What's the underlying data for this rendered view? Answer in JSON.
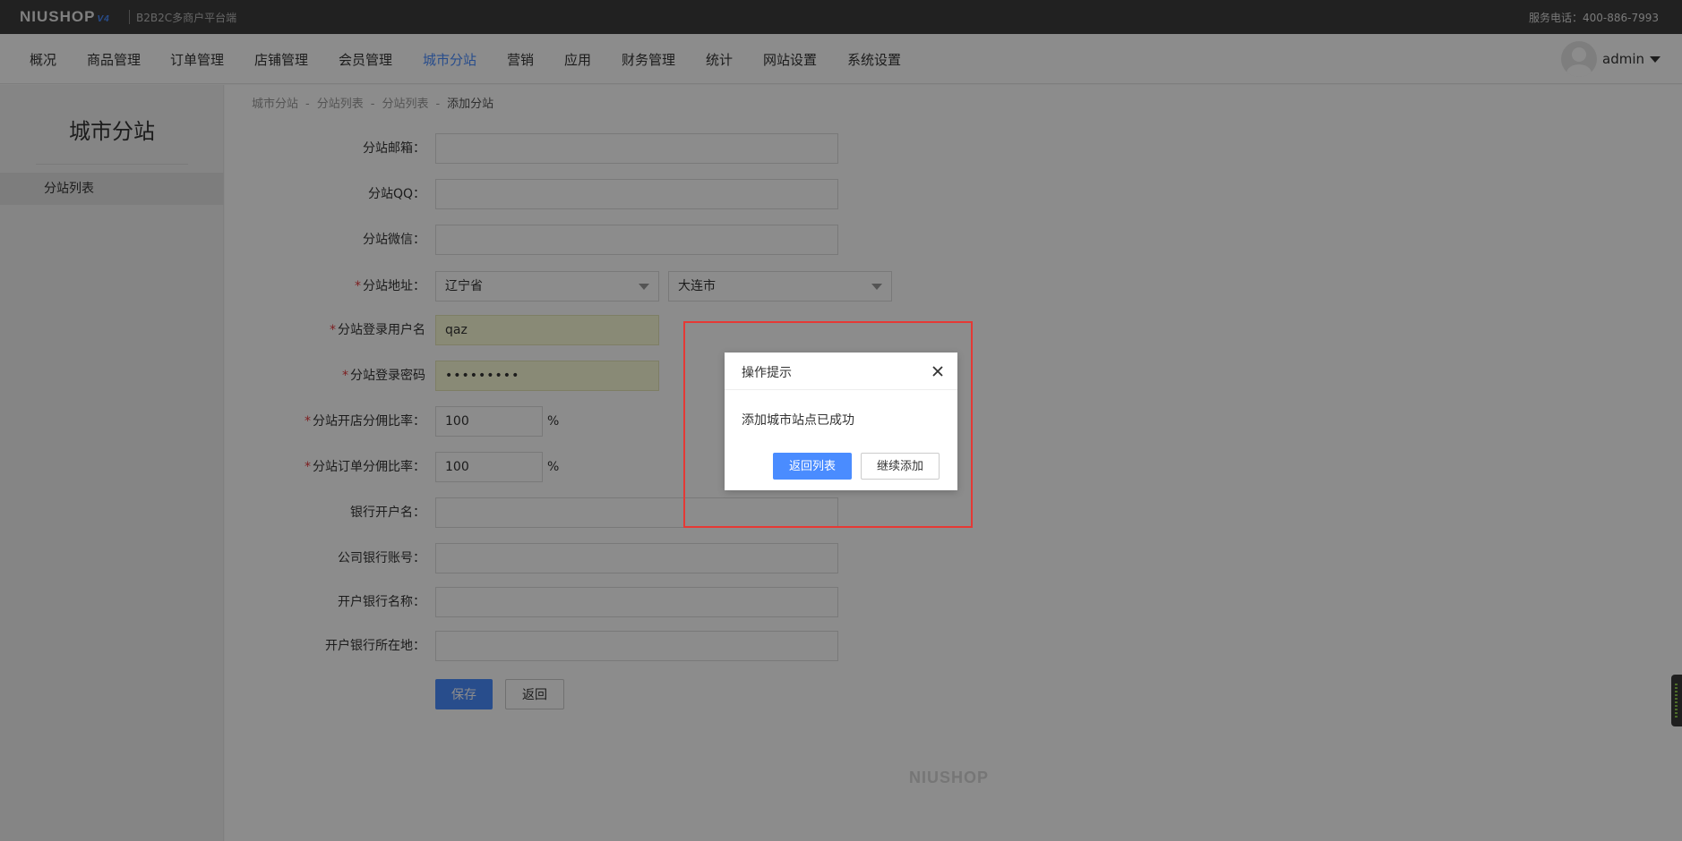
{
  "topbar": {
    "logo": "NIUSHOP",
    "logo_version": "V4",
    "subtitle": "B2B2C多商户平台端",
    "hotline": "服务电话：400-886-7993"
  },
  "nav": {
    "items": [
      "概况",
      "商品管理",
      "订单管理",
      "店铺管理",
      "会员管理",
      "城市分站",
      "营销",
      "应用",
      "财务管理",
      "统计",
      "网站设置",
      "系统设置"
    ],
    "active_index": 5,
    "user": "admin"
  },
  "sidebar": {
    "title": "城市分站",
    "items": [
      "分站列表"
    ]
  },
  "breadcrumb": [
    "城市分站",
    "分站列表",
    "分站列表",
    "添加分站"
  ],
  "form": {
    "email": {
      "label": "分站邮箱：",
      "value": ""
    },
    "qq": {
      "label": "分站QQ：",
      "value": ""
    },
    "wechat": {
      "label": "分站微信：",
      "value": ""
    },
    "address": {
      "label": "分站地址：",
      "province": "辽宁省",
      "city": "大连市"
    },
    "username": {
      "label": "分站登录用户名",
      "value": "qaz"
    },
    "password": {
      "label": "分站登录密码",
      "value": "•••••••••"
    },
    "shop_rate": {
      "label": "分站开店分佣比率：",
      "value": "100",
      "unit": "%"
    },
    "order_rate": {
      "label": "分站订单分佣比率：",
      "value": "100",
      "unit": "%"
    },
    "bank_account_name": {
      "label": "银行开户名：",
      "value": ""
    },
    "bank_account_no": {
      "label": "公司银行账号：",
      "value": ""
    },
    "bank_name": {
      "label": "开户银行名称：",
      "value": ""
    },
    "bank_location": {
      "label": "开户银行所在地：",
      "value": ""
    },
    "save_label": "保存",
    "back_label": "返回",
    "required_mark": "*"
  },
  "footer_brand": "NIUSHOP",
  "dialog": {
    "title": "操作提示",
    "message": "添加城市站点已成功",
    "primary_label": "返回列表",
    "secondary_label": "继续添加"
  },
  "colors": {
    "accent": "#4a8cff",
    "required": "#e4393c",
    "highlight_border": "#e53935"
  }
}
